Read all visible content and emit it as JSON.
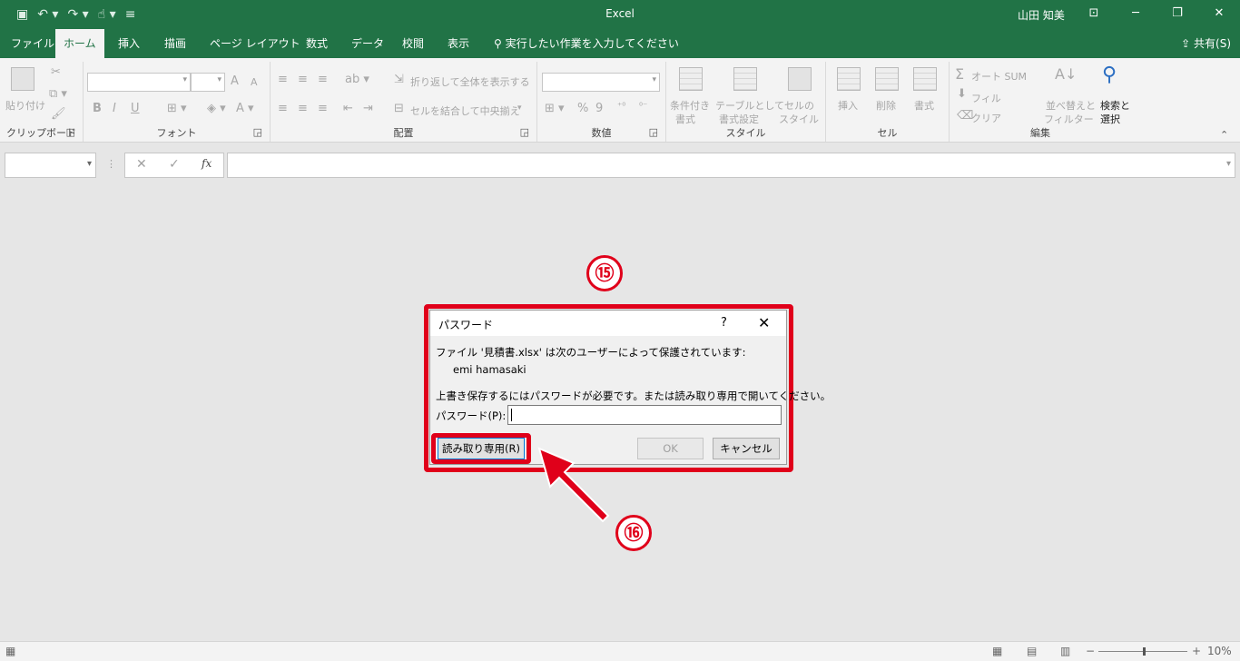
{
  "titlebar": {
    "app_title": "Excel",
    "user_name": "山田 知美",
    "qat": [
      "save-icon",
      "undo-icon",
      "redo-icon",
      "touch-mode-icon",
      "customize-icon"
    ],
    "window_buttons": [
      "ribbon-display-icon",
      "minimize-icon",
      "restore-icon",
      "close-icon"
    ]
  },
  "tabs": [
    {
      "label": "ファイル"
    },
    {
      "label": "ホーム"
    },
    {
      "label": "挿入"
    },
    {
      "label": "描画"
    },
    {
      "label": "ページ レイアウト"
    },
    {
      "label": "数式"
    },
    {
      "label": "データ"
    },
    {
      "label": "校閲"
    },
    {
      "label": "表示"
    }
  ],
  "tell_me": "実行したい作業を入力してください",
  "share": "共有(S)",
  "ribbon": {
    "clipboard": {
      "label": "クリップボード",
      "paste": "貼り付け"
    },
    "font": {
      "label": "フォント",
      "bold": "B",
      "italic": "I",
      "underline": "U",
      "grow": "A",
      "shrink": "A"
    },
    "alignment": {
      "label": "配置",
      "wrap": "折り返して全体を表示する",
      "merge": "セルを結合して中央揃え"
    },
    "number": {
      "label": "数値",
      "percent": "%",
      "comma": "9"
    },
    "styles": {
      "label": "スタイル",
      "conditional_1": "条件付き",
      "conditional_2": "書式",
      "table_1": "テーブルとして",
      "table_2": "書式設定",
      "cell_1": "セルの",
      "cell_2": "スタイル"
    },
    "cells": {
      "label": "セル",
      "insert": "挿入",
      "delete": "削除",
      "format": "書式"
    },
    "editing": {
      "label": "編集",
      "autosum": "オート SUM",
      "fill": "フィル",
      "clear": "クリア",
      "sort_1": "並べ替えと",
      "sort_2": "フィルター",
      "find_1": "検索と",
      "find_2": "選択"
    }
  },
  "formula_bar": {
    "cancel": "✕",
    "enter": "✓",
    "fx": "fx",
    "dots": "⋮"
  },
  "dialog": {
    "title": "パスワード",
    "help": "?",
    "close": "✕",
    "line1": "ファイル '見積書.xlsx' は次のユーザーによって保護されています:",
    "line2": "emi hamasaki",
    "line3": "上書き保存するにはパスワードが必要です。または読み取り専用で開いてください。",
    "password_label": "パスワード(P):",
    "password_value": "",
    "readonly_button": "読み取り専用(R)",
    "ok_button": "OK",
    "cancel_button": "キャンセル"
  },
  "annotations": {
    "badge_15": "⑮",
    "badge_16": "⑯",
    "highlight_color": "#e0001a"
  },
  "status": {
    "zoom": "10%",
    "zoom_out": "−",
    "zoom_in": "+"
  }
}
